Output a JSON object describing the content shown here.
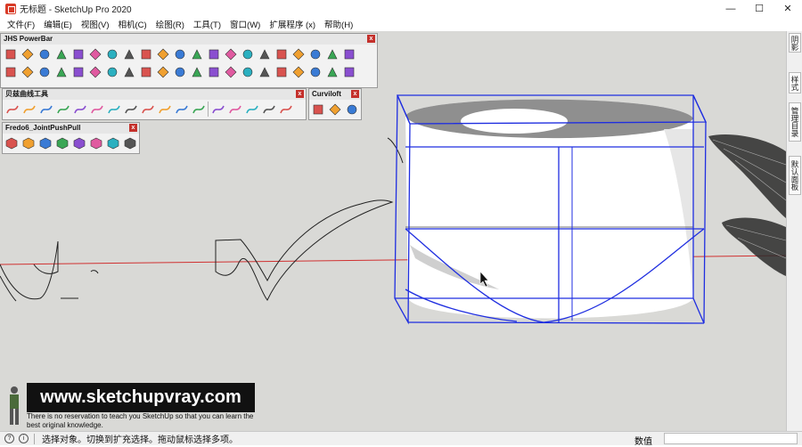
{
  "window": {
    "title": "无标题 - SketchUp Pro 2020",
    "minimize": "—",
    "maximize": "☐",
    "close": "✕"
  },
  "menu": [
    {
      "label": "文件(F)"
    },
    {
      "label": "编辑(E)"
    },
    {
      "label": "视图(V)"
    },
    {
      "label": "相机(C)"
    },
    {
      "label": "绘图(R)"
    },
    {
      "label": "工具(T)"
    },
    {
      "label": "窗口(W)"
    },
    {
      "label": "扩展程序 (x)"
    },
    {
      "label": "帮助(H)"
    }
  ],
  "toolbars": {
    "jhs": {
      "title": "JHS PowerBar",
      "close": "x"
    },
    "bezier": {
      "title": "贝兹曲线工具",
      "close": "x"
    },
    "curviloft": {
      "title": "Curviloft",
      "close": "x"
    },
    "fredo": {
      "title": "Fredo6_JointPushPull",
      "close": "x"
    }
  },
  "side_tabs": [
    {
      "label": "阴影"
    },
    {
      "label": "样式"
    },
    {
      "label": "管理目录"
    },
    {
      "label": "默认面板"
    }
  ],
  "watermark": {
    "banner": "www.sketchupvray.com",
    "caption": "There is no reservation to teach you SketchUp so that you can learn the best original knowledge."
  },
  "status": {
    "message": "选择对象。切换到扩充选择。拖动鼠标选择多项。",
    "measurements_label": "数值",
    "icon1": "?",
    "icon2": "i"
  },
  "colors": {
    "viewport_bg": "#d9d9d6",
    "selection_blue": "#1f2ee0",
    "axis_red": "#d03030",
    "toolbar_close": "#c4302b"
  }
}
